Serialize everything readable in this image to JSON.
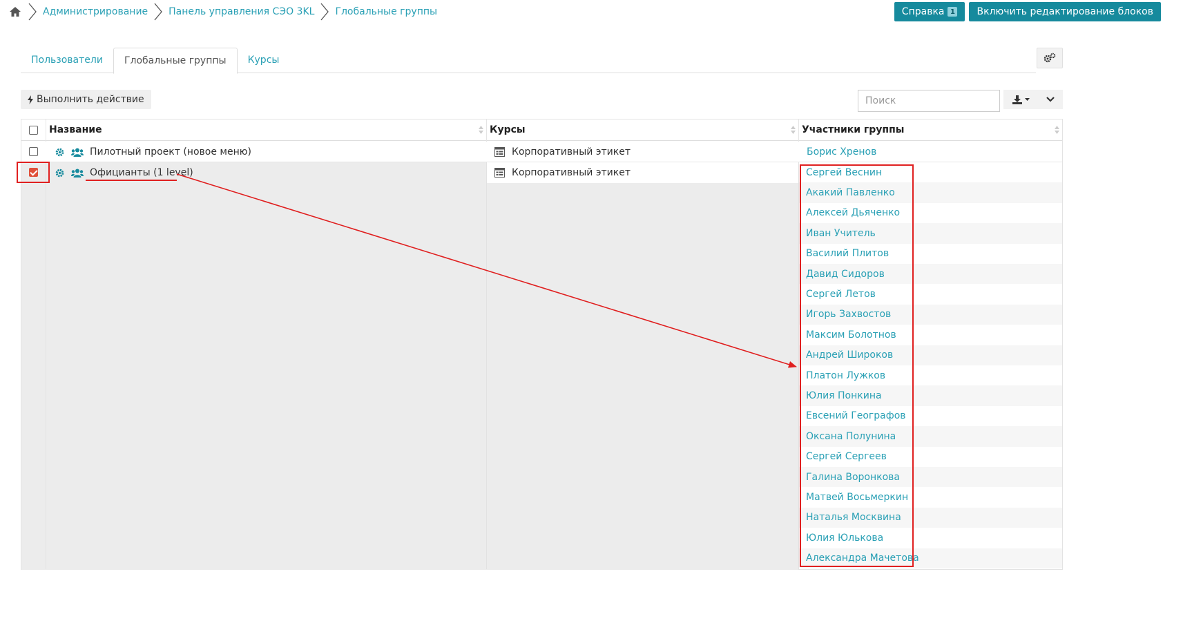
{
  "breadcrumb": {
    "home_icon": "home-icon",
    "items": [
      {
        "label": "Администрирование"
      },
      {
        "label": "Панель управления СЭО 3KL"
      },
      {
        "label": "Глобальные группы"
      }
    ]
  },
  "header_buttons": {
    "help_label": "Справка",
    "help_badge": "1",
    "edit_blocks_label": "Включить редактирование блоков"
  },
  "tabs": [
    {
      "label": "Пользователи",
      "active": false
    },
    {
      "label": "Глобальные группы",
      "active": true
    },
    {
      "label": "Курсы",
      "active": false
    }
  ],
  "toolbar": {
    "action_label": "Выполнить действие",
    "search_placeholder": "Поиск"
  },
  "table": {
    "columns": [
      "Название",
      "Курсы",
      "Участники группы"
    ],
    "rows": [
      {
        "name": "Пилотный проект (новое меню)",
        "course": "Корпоративный этикет",
        "checked": false,
        "members": [
          "Борис Хренов"
        ]
      },
      {
        "name": "Официанты (1 level)",
        "course": "Корпоративный этикет",
        "checked": true,
        "members": [
          "Сергей Веснин",
          "Акакий Павленко",
          "Алексей Дьяченко",
          "Иван Учитель",
          "Василий Плитов",
          "Давид Сидоров",
          "Сергей Летов",
          "Игорь Захвостов",
          "Максим Болотнов",
          "Андрей Широков",
          "Платон Лужков",
          "Юлия Понкина",
          "Евсений Географов",
          "Оксана Полунина",
          "Сергей Сергеев",
          "Галина Воронкова",
          "Матвей Восьмеркин",
          "Наталья Москвина",
          "Юлия Юлькова",
          "Александра Мачетова"
        ]
      }
    ]
  },
  "colors": {
    "accent": "#2aa0b5",
    "button": "#168a9d",
    "annotation": "#e02020",
    "checkbox_checked": "#e0503a"
  }
}
